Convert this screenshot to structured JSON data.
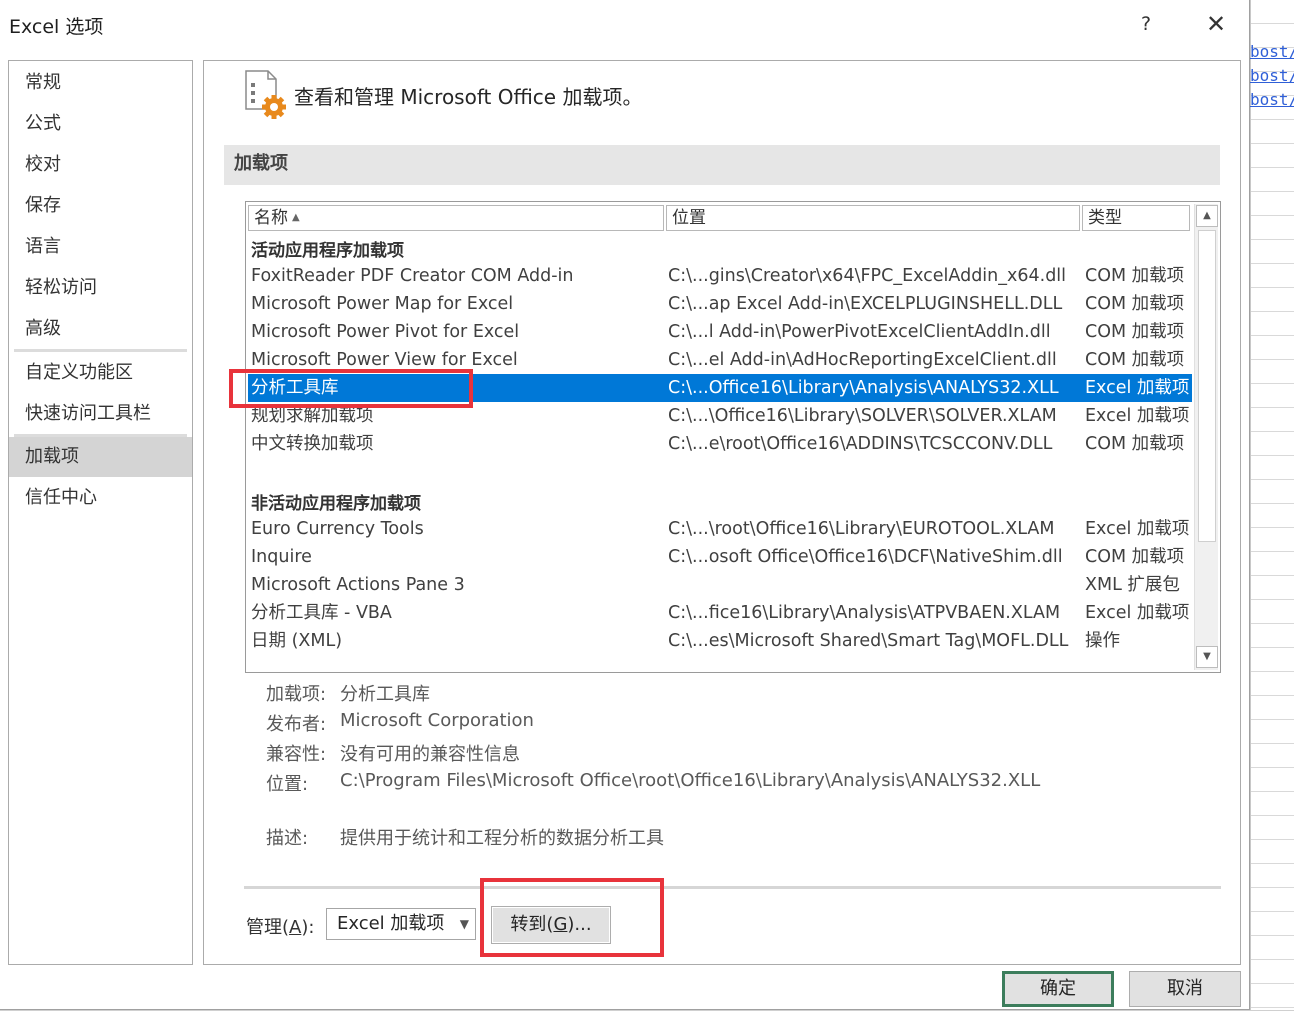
{
  "background": {
    "links": [
      "bost/",
      "bost/",
      "bost/"
    ]
  },
  "dialog": {
    "title": "Excel 选项",
    "help_label": "?",
    "close_label": "✕"
  },
  "nav": {
    "items": [
      {
        "label": "常规"
      },
      {
        "label": "公式"
      },
      {
        "label": "校对"
      },
      {
        "label": "保存"
      },
      {
        "label": "语言"
      },
      {
        "label": "轻松访问"
      },
      {
        "label": "高级"
      },
      {
        "label": "自定义功能区"
      },
      {
        "label": "快速访问工具栏"
      },
      {
        "label": "加载项",
        "active": true
      },
      {
        "label": "信任中心"
      }
    ]
  },
  "content": {
    "header_icon": "addin-gear-icon",
    "header_text": "查看和管理 Microsoft Office 加载项。",
    "section_title": "加载项",
    "columns": {
      "name": "名称",
      "location": "位置",
      "type": "类型"
    },
    "sort_indicator": "▲",
    "active_group_title": "活动应用程序加载项",
    "active_addins": [
      {
        "name": "FoxitReader PDF Creator COM Add-in",
        "location": "C:\\...gins\\Creator\\x64\\FPC_ExcelAddin_x64.dll",
        "type": "COM 加载项"
      },
      {
        "name": "Microsoft Power Map for Excel",
        "location": "C:\\...ap Excel Add-in\\EXCELPLUGINSHELL.DLL",
        "type": "COM 加载项"
      },
      {
        "name": "Microsoft Power Pivot for Excel",
        "location": "C:\\...l Add-in\\PowerPivotExcelClientAddIn.dll",
        "type": "COM 加载项"
      },
      {
        "name": "Microsoft Power View for Excel",
        "location": "C:\\...el Add-in\\AdHocReportingExcelClient.dll",
        "type": "COM 加载项"
      },
      {
        "name": "分析工具库",
        "location": "C:\\...Office16\\Library\\Analysis\\ANALYS32.XLL",
        "type": "Excel 加载项",
        "selected": true
      },
      {
        "name": "规划求解加载项",
        "location": "C:\\...\\Office16\\Library\\SOLVER\\SOLVER.XLAM",
        "type": "Excel 加载项"
      },
      {
        "name": "中文转换加载项",
        "location": "C:\\...e\\root\\Office16\\ADDINS\\TCSCCONV.DLL",
        "type": "COM 加载项"
      }
    ],
    "inactive_group_title": "非活动应用程序加载项",
    "inactive_addins": [
      {
        "name": "Euro Currency Tools",
        "location": "C:\\...\\root\\Office16\\Library\\EUROTOOL.XLAM",
        "type": "Excel 加载项"
      },
      {
        "name": "Inquire",
        "location": "C:\\...osoft Office\\Office16\\DCF\\NativeShim.dll",
        "type": "COM 加载项"
      },
      {
        "name": "Microsoft Actions Pane 3",
        "location": "",
        "type": "XML 扩展包"
      },
      {
        "name": "分析工具库 - VBA",
        "location": "C:\\...fice16\\Library\\Analysis\\ATPVBAEN.XLAM",
        "type": "Excel 加载项"
      },
      {
        "name": "日期 (XML)",
        "location": "C:\\...es\\Microsoft Shared\\Smart Tag\\MOFL.DLL",
        "type": "操作"
      }
    ],
    "details": {
      "addin_label": "加载项:",
      "addin_value": "分析工具库",
      "publisher_label": "发布者:",
      "publisher_value": "Microsoft Corporation",
      "compat_label": "兼容性:",
      "compat_value": "没有可用的兼容性信息",
      "location_label": "位置:",
      "location_value": "C:\\Program Files\\Microsoft Office\\root\\Office16\\Library\\Analysis\\ANALYS32.XLL",
      "desc_label": "描述:",
      "desc_value": "提供用于统计和工程分析的数据分析工具"
    },
    "manage": {
      "label_prefix": "管理(",
      "label_accel": "A",
      "label_suffix": "):",
      "selected": "Excel 加载项",
      "go_prefix": "转到(",
      "go_accel": "G",
      "go_suffix": ")..."
    }
  },
  "footer": {
    "ok_label": "确定",
    "cancel_label": "取消"
  },
  "colors": {
    "selection": "#0078d7",
    "highlight_box": "#e8333b",
    "ok_border": "#3c7d5c"
  }
}
